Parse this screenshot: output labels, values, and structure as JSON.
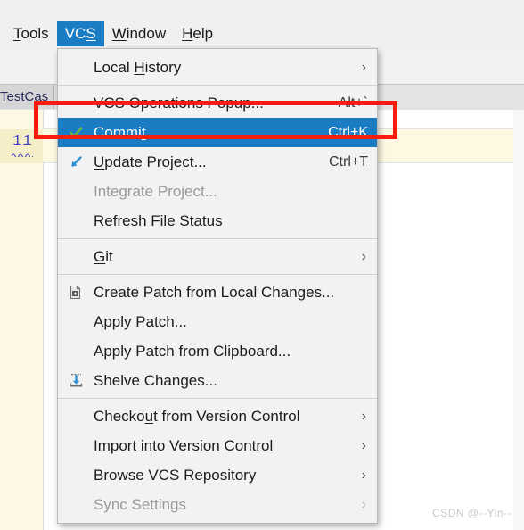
{
  "app": {
    "watermark": "CSDN @--Yin--"
  },
  "menubar": {
    "items": [
      {
        "label": "Tools",
        "mnemonic_index": 0,
        "active": false
      },
      {
        "label": "VCS",
        "mnemonic_index": 2,
        "active": true
      },
      {
        "label": "Window",
        "mnemonic_index": 0,
        "active": false
      },
      {
        "label": "Help",
        "mnemonic_index": 0,
        "active": false
      }
    ]
  },
  "editor": {
    "tab_label": "TestCas",
    "line_number": "11"
  },
  "vcs_menu": {
    "groups": [
      {
        "items": [
          {
            "label": "Local History",
            "mnemonic_index": 6,
            "shortcut": "",
            "icon": "",
            "submenu": true,
            "disabled": false,
            "selected": false
          }
        ]
      },
      {
        "items": [
          {
            "label": "VCS Operations Popup...",
            "mnemonic_index": -1,
            "shortcut": "Alt+`",
            "icon": "",
            "submenu": false,
            "disabled": false,
            "selected": false
          },
          {
            "label": "Commit...",
            "mnemonic_index": 5,
            "shortcut": "Ctrl+K",
            "icon": "check-icon",
            "submenu": false,
            "disabled": false,
            "selected": true
          },
          {
            "label": "Update Project...",
            "mnemonic_index": 0,
            "shortcut": "Ctrl+T",
            "icon": "update-arrow-icon",
            "submenu": false,
            "disabled": false,
            "selected": false
          },
          {
            "label": "Integrate Project...",
            "mnemonic_index": -1,
            "shortcut": "",
            "icon": "",
            "submenu": false,
            "disabled": true,
            "selected": false
          },
          {
            "label": "Refresh File Status",
            "mnemonic_index": 1,
            "shortcut": "",
            "icon": "",
            "submenu": false,
            "disabled": false,
            "selected": false
          }
        ]
      },
      {
        "items": [
          {
            "label": "Git",
            "mnemonic_index": 0,
            "shortcut": "",
            "icon": "",
            "submenu": true,
            "disabled": false,
            "selected": false
          }
        ]
      },
      {
        "items": [
          {
            "label": "Create Patch from Local Changes...",
            "mnemonic_index": -1,
            "shortcut": "",
            "icon": "create-patch-icon",
            "submenu": false,
            "disabled": false,
            "selected": false
          },
          {
            "label": "Apply Patch...",
            "mnemonic_index": -1,
            "shortcut": "",
            "icon": "",
            "submenu": false,
            "disabled": false,
            "selected": false
          },
          {
            "label": "Apply Patch from Clipboard...",
            "mnemonic_index": -1,
            "shortcut": "",
            "icon": "",
            "submenu": false,
            "disabled": false,
            "selected": false
          },
          {
            "label": "Shelve Changes...",
            "mnemonic_index": -1,
            "shortcut": "",
            "icon": "shelve-icon",
            "submenu": false,
            "disabled": false,
            "selected": false
          }
        ]
      },
      {
        "items": [
          {
            "label": "Checkout from Version Control",
            "mnemonic_index": 6,
            "shortcut": "",
            "icon": "",
            "submenu": true,
            "disabled": false,
            "selected": false
          },
          {
            "label": "Import into Version Control",
            "mnemonic_index": -1,
            "shortcut": "",
            "icon": "",
            "submenu": true,
            "disabled": false,
            "selected": false
          },
          {
            "label": "Browse VCS Repository",
            "mnemonic_index": -1,
            "shortcut": "",
            "icon": "",
            "submenu": true,
            "disabled": false,
            "selected": false
          },
          {
            "label": "Sync Settings",
            "mnemonic_index": -1,
            "shortcut": "",
            "icon": "",
            "submenu": true,
            "disabled": true,
            "selected": false
          }
        ]
      }
    ]
  },
  "annotation": {
    "color": "#f81c0c",
    "target": "Commit..."
  },
  "colors": {
    "menu_highlight": "#1a7dc4",
    "menu_background": "#f2f2f2",
    "check_green": "#59a869",
    "annotation_red": "#f81c0c",
    "caret_line": "#fdf8e2"
  }
}
